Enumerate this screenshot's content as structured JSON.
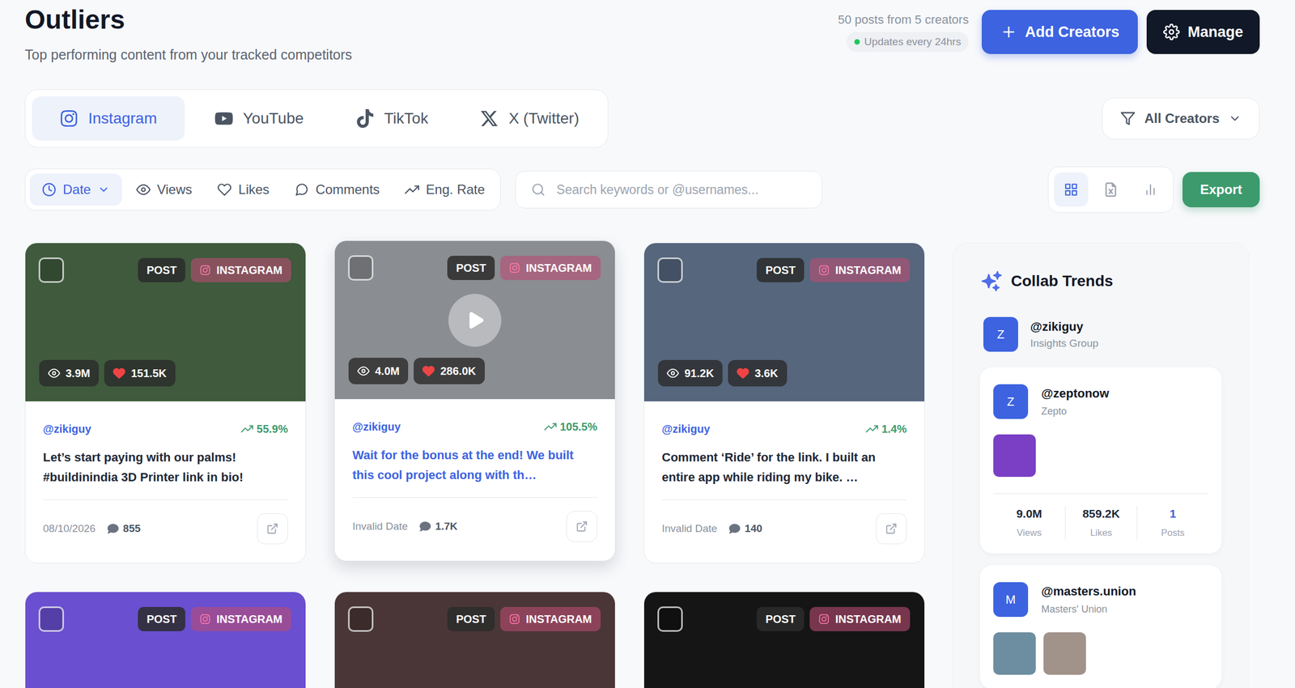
{
  "header": {
    "title": "Outliers",
    "subtitle": "Top performing content from your tracked competitors",
    "summary": "50 posts from 5 creators",
    "update_status": "Updates every 24hrs",
    "add_button": "Add Creators",
    "manage_button": "Manage"
  },
  "platform_tabs": [
    {
      "label": "Instagram",
      "kind": "instagram",
      "selected": true
    },
    {
      "label": "YouTube",
      "kind": "youtube",
      "selected": false
    },
    {
      "label": "TikTok",
      "kind": "tiktok",
      "selected": false
    },
    {
      "label": "X (Twitter)",
      "kind": "x",
      "selected": false
    }
  ],
  "creator_filter": {
    "label": "All Creators"
  },
  "sort_options": [
    {
      "label": "Date",
      "kind": "date",
      "selected": true
    },
    {
      "label": "Views",
      "kind": "views",
      "selected": false
    },
    {
      "label": "Likes",
      "kind": "likes",
      "selected": false
    },
    {
      "label": "Comments",
      "kind": "comments",
      "selected": false
    },
    {
      "label": "Eng. Rate",
      "kind": "eng",
      "selected": false
    }
  ],
  "search": {
    "placeholder": "Search keywords or @usernames..."
  },
  "view_modes": [
    {
      "kind": "grid",
      "selected": true
    },
    {
      "kind": "sheet",
      "selected": false
    },
    {
      "kind": "chart",
      "selected": false
    }
  ],
  "export_button": "Export",
  "posts": [
    {
      "type": "POST",
      "platform": "INSTAGRAM",
      "checked": false,
      "video": false,
      "hovered": false,
      "views": "3.9M",
      "likes": "151.5K",
      "handle": "@zikiguy",
      "eng_rate": "55.9%",
      "title": "Let’s start paying with our palms! #buildinindia 3D Printer link in bio!",
      "date": "08/10/2026",
      "comments": "855"
    },
    {
      "type": "POST",
      "platform": "INSTAGRAM",
      "checked": false,
      "video": true,
      "hovered": true,
      "views": "4.0M",
      "likes": "286.0K",
      "handle": "@zikiguy",
      "eng_rate": "105.5%",
      "title": "Wait for the bonus at the end! We built this cool project along with th…",
      "date": "Invalid Date",
      "comments": "1.7K"
    },
    {
      "type": "POST",
      "platform": "INSTAGRAM",
      "checked": false,
      "video": false,
      "hovered": false,
      "views": "91.2K",
      "likes": "3.6K",
      "handle": "@zikiguy",
      "eng_rate": "1.4%",
      "title": "Comment ‘Ride’ for the link. I built an entire app while riding my bike. …",
      "date": "Invalid Date",
      "comments": "140"
    },
    {
      "type": "POST",
      "platform": "INSTAGRAM",
      "checked": false
    },
    {
      "type": "POST",
      "platform": "INSTAGRAM",
      "checked": false
    },
    {
      "type": "POST",
      "platform": "INSTAGRAM",
      "checked": false
    }
  ],
  "collab_trends": {
    "title": "Collab Trends",
    "creator": {
      "avatar": "Z",
      "handle": "@zikiguy",
      "group": "Insights Group"
    },
    "collabs": [
      {
        "avatar": "Z",
        "handle": "@zeptonow",
        "name": "Zepto",
        "thumbnail_count": 1,
        "stats": [
          {
            "value": "9.0M",
            "label": "Views",
            "highlight": false
          },
          {
            "value": "859.2K",
            "label": "Likes",
            "highlight": false
          },
          {
            "value": "1",
            "label": "Posts",
            "highlight": true
          }
        ]
      },
      {
        "avatar": "M",
        "handle": "@masters.union",
        "name": "Masters' Union",
        "thumbnail_count": 2
      }
    ]
  }
}
